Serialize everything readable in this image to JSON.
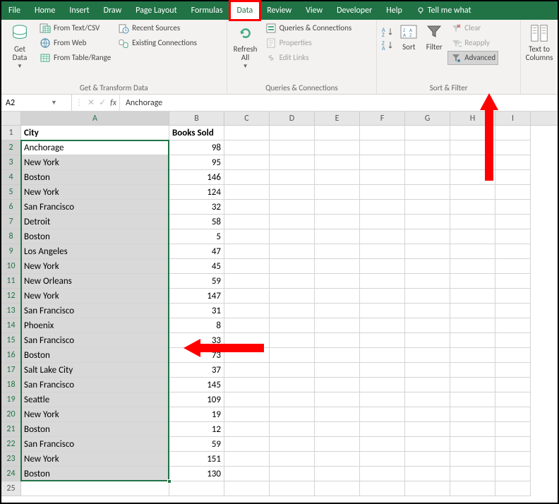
{
  "tabs": [
    "File",
    "Home",
    "Insert",
    "Draw",
    "Page Layout",
    "Formulas",
    "Data",
    "Review",
    "View",
    "Developer",
    "Help"
  ],
  "active_tab": "Data",
  "tell_me": "Tell me what",
  "ribbon": {
    "get_data": "Get\nData",
    "from_text": "From Text/CSV",
    "from_web": "From Web",
    "from_table": "From Table/Range",
    "recent_sources": "Recent Sources",
    "existing_conn": "Existing Connections",
    "group1": "Get & Transform Data",
    "refresh_all": "Refresh\nAll",
    "queries_conn": "Queries & Connections",
    "properties": "Properties",
    "edit_links": "Edit Links",
    "group2": "Queries & Connections",
    "sort": "Sort",
    "filter": "Filter",
    "clear": "Clear",
    "reapply": "Reapply",
    "advanced": "Advanced",
    "group3": "Sort & Filter",
    "text_to_cols": "Text to\nColumns"
  },
  "name_box": "A2",
  "formula_value": "Anchorage",
  "columns": [
    "A",
    "B",
    "C",
    "D",
    "E",
    "F",
    "G",
    "H",
    "I"
  ],
  "header": {
    "a": "City",
    "b": "Books Sold"
  },
  "rows": [
    {
      "n": 2,
      "a": "Anchorage",
      "b": 98
    },
    {
      "n": 3,
      "a": "New York",
      "b": 95
    },
    {
      "n": 4,
      "a": "Boston",
      "b": 146
    },
    {
      "n": 5,
      "a": "New York",
      "b": 124
    },
    {
      "n": 6,
      "a": "San Francisco",
      "b": 32
    },
    {
      "n": 7,
      "a": "Detroit",
      "b": 58
    },
    {
      "n": 8,
      "a": "Boston",
      "b": 5
    },
    {
      "n": 9,
      "a": "Los Angeles",
      "b": 47
    },
    {
      "n": 10,
      "a": "New York",
      "b": 45
    },
    {
      "n": 11,
      "a": "New Orleans",
      "b": 59
    },
    {
      "n": 12,
      "a": "New York",
      "b": 147
    },
    {
      "n": 13,
      "a": "San Francisco",
      "b": 31
    },
    {
      "n": 14,
      "a": "Phoenix",
      "b": 8
    },
    {
      "n": 15,
      "a": "San Francisco",
      "b": 33
    },
    {
      "n": 16,
      "a": "Boston",
      "b": 73
    },
    {
      "n": 17,
      "a": "Salt Lake City",
      "b": 37
    },
    {
      "n": 18,
      "a": "San Francisco",
      "b": 145
    },
    {
      "n": 19,
      "a": "Seattle",
      "b": 109
    },
    {
      "n": 20,
      "a": "New York",
      "b": 19
    },
    {
      "n": 21,
      "a": "Boston",
      "b": 12
    },
    {
      "n": 22,
      "a": "San Francisco",
      "b": 59
    },
    {
      "n": 23,
      "a": "New York",
      "b": 151
    },
    {
      "n": 24,
      "a": "Boston",
      "b": 130
    }
  ]
}
